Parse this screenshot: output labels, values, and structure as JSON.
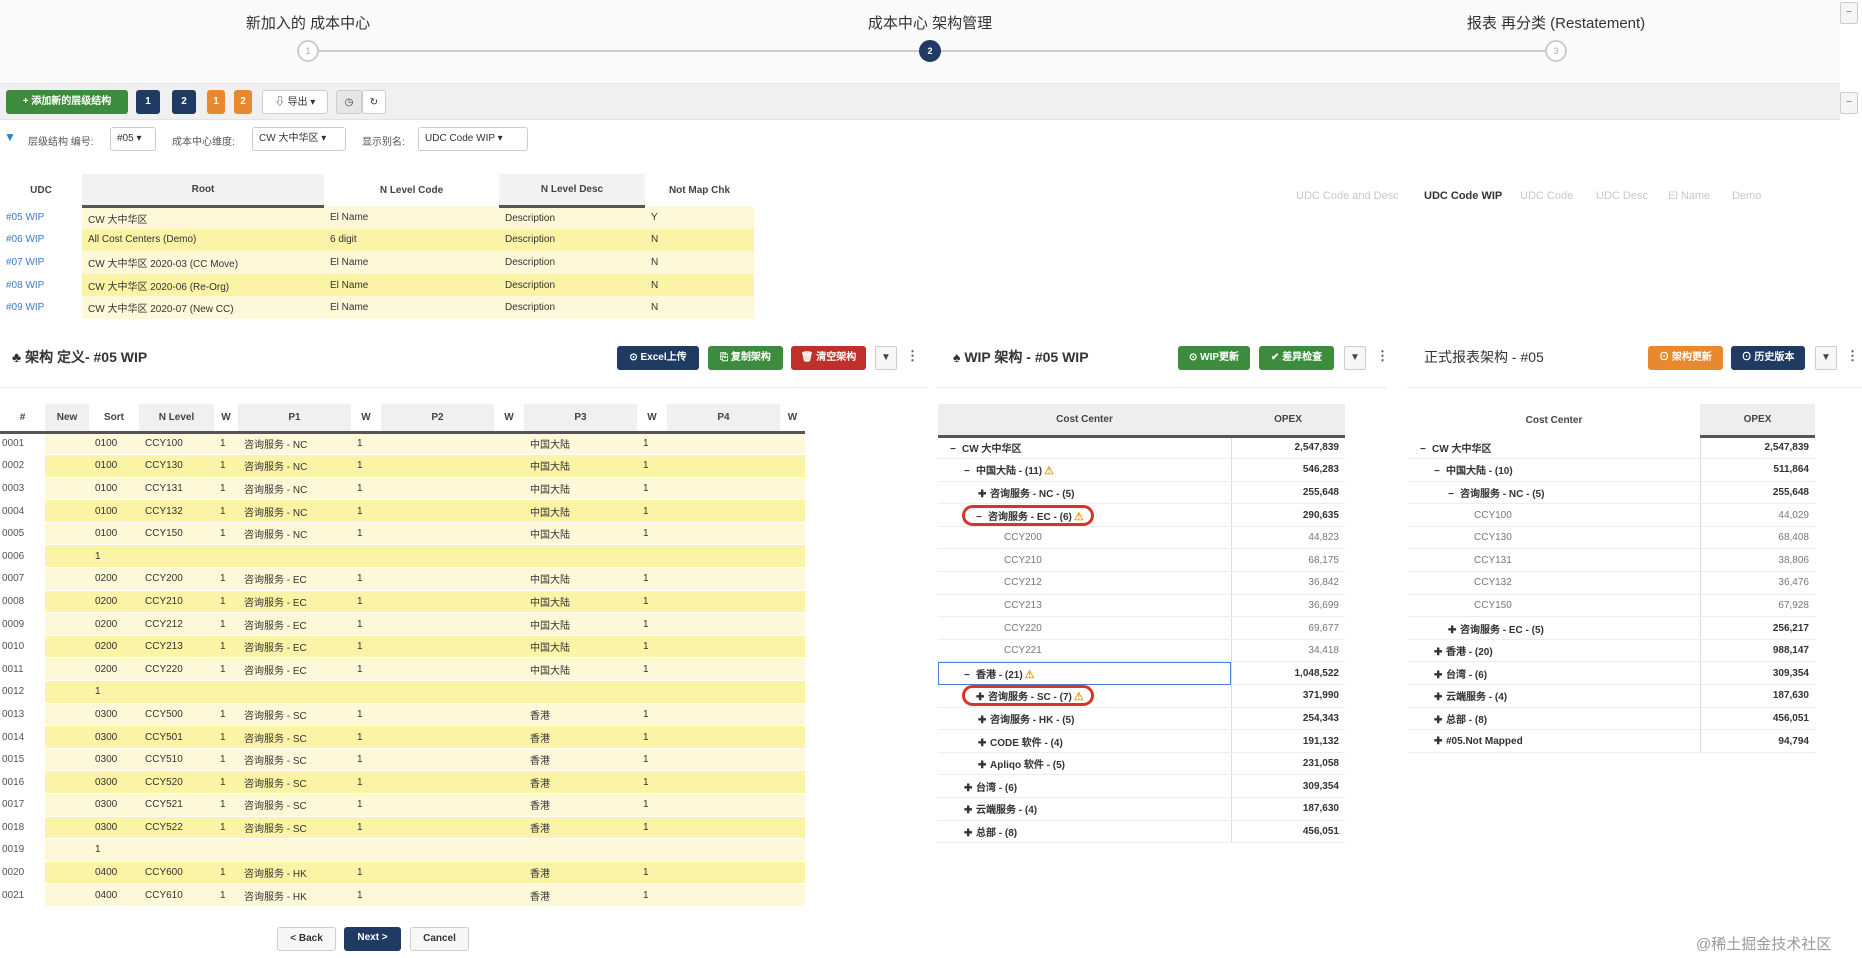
{
  "stepper": {
    "steps": [
      {
        "label": "新加入的 成本中心",
        "num": "1"
      },
      {
        "label": "成本中心 架构管理",
        "num": "2"
      },
      {
        "label": "报表 再分类 (Restatement)",
        "num": "3"
      }
    ],
    "active": 2
  },
  "toolbar": {
    "add": "+ 添加新的层级结构",
    "b1": "1",
    "b2": "2",
    "o1": "1",
    "o2": "2",
    "export": "导出 ▾",
    "history_icon": "clock-icon",
    "refresh_icon": "refresh-icon"
  },
  "filters": {
    "l1": "层级结构 编号:",
    "v1": "#05 ▾",
    "l2": "成本中心维度:",
    "v2": "CW 大中华区 ▾",
    "l3": "显示别名:",
    "v3": "UDC Code WIP ▾"
  },
  "udc_table": {
    "headers": [
      "UDC",
      "Root",
      "N Level Code",
      "N Level Desc",
      "Not Map Chk"
    ],
    "rows": [
      [
        "#05 WIP",
        "CW 大中华区",
        "El Name",
        "Description",
        "Y"
      ],
      [
        "#06 WIP",
        "All Cost Centers (Demo)",
        "6 digit",
        "Description",
        "N"
      ],
      [
        "#07 WIP",
        "CW 大中华区 2020-03 (CC Move)",
        "El Name",
        "Description",
        "N"
      ],
      [
        "#08 WIP",
        "CW 大中华区 2020-06 (Re-Org)",
        "El Name",
        "Description",
        "N"
      ],
      [
        "#09 WIP",
        "CW 大中华区 2020-07 (New CC)",
        "El Name",
        "Description",
        "N"
      ]
    ]
  },
  "view_tabs": [
    {
      "label": "UDC Code and Desc",
      "active": false
    },
    {
      "label": "UDC Code WIP",
      "active": true
    },
    {
      "label": "UDC Code",
      "active": false
    },
    {
      "label": "UDC Desc",
      "active": false
    },
    {
      "label": "El Name",
      "active": false
    },
    {
      "label": "Demo",
      "active": false
    }
  ],
  "left_panel": {
    "title": "架构 定义- #05 WIP",
    "excel": "⊙ Excel上传",
    "copy": "复制架构",
    "clear": "清空架构",
    "headers": [
      "#",
      "New",
      "Sort",
      "N Level",
      "W",
      "P1",
      "W",
      "P2",
      "W",
      "P3",
      "W",
      "P4",
      "W"
    ],
    "rows": [
      [
        "0001",
        "",
        "0100",
        "CCY100",
        "1",
        "咨询服务 - NC",
        "1",
        "",
        "",
        "中国大陆",
        "1",
        "",
        ""
      ],
      [
        "0002",
        "",
        "0100",
        "CCY130",
        "1",
        "咨询服务 - NC",
        "1",
        "",
        "",
        "中国大陆",
        "1",
        "",
        ""
      ],
      [
        "0003",
        "",
        "0100",
        "CCY131",
        "1",
        "咨询服务 - NC",
        "1",
        "",
        "",
        "中国大陆",
        "1",
        "",
        ""
      ],
      [
        "0004",
        "",
        "0100",
        "CCY132",
        "1",
        "咨询服务 - NC",
        "1",
        "",
        "",
        "中国大陆",
        "1",
        "",
        ""
      ],
      [
        "0005",
        "",
        "0100",
        "CCY150",
        "1",
        "咨询服务 - NC",
        "1",
        "",
        "",
        "中国大陆",
        "1",
        "",
        ""
      ],
      [
        "0006",
        "",
        "1",
        "",
        "",
        "",
        "",
        "",
        "",
        "",
        "",
        "",
        ""
      ],
      [
        "0007",
        "",
        "0200",
        "CCY200",
        "1",
        "咨询服务 - EC",
        "1",
        "",
        "",
        "中国大陆",
        "1",
        "",
        ""
      ],
      [
        "0008",
        "",
        "0200",
        "CCY210",
        "1",
        "咨询服务 - EC",
        "1",
        "",
        "",
        "中国大陆",
        "1",
        "",
        ""
      ],
      [
        "0009",
        "",
        "0200",
        "CCY212",
        "1",
        "咨询服务 - EC",
        "1",
        "",
        "",
        "中国大陆",
        "1",
        "",
        ""
      ],
      [
        "0010",
        "",
        "0200",
        "CCY213",
        "1",
        "咨询服务 - EC",
        "1",
        "",
        "",
        "中国大陆",
        "1",
        "",
        ""
      ],
      [
        "0011",
        "",
        "0200",
        "CCY220",
        "1",
        "咨询服务 - EC",
        "1",
        "",
        "",
        "中国大陆",
        "1",
        "",
        ""
      ],
      [
        "0012",
        "",
        "1",
        "",
        "",
        "",
        "",
        "",
        "",
        "",
        "",
        "",
        ""
      ],
      [
        "0013",
        "",
        "0300",
        "CCY500",
        "1",
        "咨询服务 - SC",
        "1",
        "",
        "",
        "香港",
        "1",
        "",
        ""
      ],
      [
        "0014",
        "",
        "0300",
        "CCY501",
        "1",
        "咨询服务 - SC",
        "1",
        "",
        "",
        "香港",
        "1",
        "",
        ""
      ],
      [
        "0015",
        "",
        "0300",
        "CCY510",
        "1",
        "咨询服务 - SC",
        "1",
        "",
        "",
        "香港",
        "1",
        "",
        ""
      ],
      [
        "0016",
        "",
        "0300",
        "CCY520",
        "1",
        "咨询服务 - SC",
        "1",
        "",
        "",
        "香港",
        "1",
        "",
        ""
      ],
      [
        "0017",
        "",
        "0300",
        "CCY521",
        "1",
        "咨询服务 - SC",
        "1",
        "",
        "",
        "香港",
        "1",
        "",
        ""
      ],
      [
        "0018",
        "",
        "0300",
        "CCY522",
        "1",
        "咨询服务 - SC",
        "1",
        "",
        "",
        "香港",
        "1",
        "",
        ""
      ],
      [
        "0019",
        "",
        "1",
        "",
        "",
        "",
        "",
        "",
        "",
        "",
        "",
        "",
        ""
      ],
      [
        "0020",
        "",
        "0400",
        "CCY600",
        "1",
        "咨询服务 - HK",
        "1",
        "",
        "",
        "香港",
        "1",
        "",
        ""
      ],
      [
        "0021",
        "",
        "0400",
        "CCY610",
        "1",
        "咨询服务 - HK",
        "1",
        "",
        "",
        "香港",
        "1",
        "",
        ""
      ]
    ]
  },
  "wip_panel": {
    "title": "WIP 架构 - #05 WIP",
    "update": "⊙ WIP更新",
    "check": "✔ 差异检查",
    "headers": [
      "Cost Center",
      "OPEX"
    ],
    "rows": [
      {
        "level": 0,
        "toggle": "−",
        "label": "CW 大中华区",
        "value": "2,547,839"
      },
      {
        "level": 1,
        "toggle": "−",
        "label": "中国大陆 - (11)",
        "warn": true,
        "value": "546,283"
      },
      {
        "level": 2,
        "toggle": "+",
        "label": "咨询服务 - NC - (5)",
        "value": "255,648"
      },
      {
        "level": 2,
        "toggle": "−",
        "label": "咨询服务 - EC - (6)",
        "warn": true,
        "highlight": true,
        "value": "290,635"
      },
      {
        "level": 3,
        "label": "CCY200",
        "value": "44,823"
      },
      {
        "level": 3,
        "label": "CCY210",
        "value": "68,175"
      },
      {
        "level": 3,
        "label": "CCY212",
        "value": "36,842"
      },
      {
        "level": 3,
        "label": "CCY213",
        "value": "36,699"
      },
      {
        "level": 3,
        "label": "CCY220",
        "value": "69,677"
      },
      {
        "level": 3,
        "label": "CCY221",
        "value": "34,418"
      },
      {
        "level": 1,
        "toggle": "−",
        "label": "香港 - (21)",
        "warn": true,
        "selected": true,
        "value": "1,048,522"
      },
      {
        "level": 2,
        "toggle": "+",
        "label": "咨询服务 - SC - (7)",
        "warn": true,
        "highlight": true,
        "value": "371,990"
      },
      {
        "level": 2,
        "toggle": "+",
        "label": "咨询服务 - HK - (5)",
        "value": "254,343"
      },
      {
        "level": 2,
        "toggle": "+",
        "label": "CODE 软件 - (4)",
        "value": "191,132"
      },
      {
        "level": 2,
        "toggle": "+",
        "label": "Apliqo 软件 - (5)",
        "value": "231,058"
      },
      {
        "level": 1,
        "toggle": "+",
        "label": "台湾 - (6)",
        "value": "309,354"
      },
      {
        "level": 1,
        "toggle": "+",
        "label": "云端服务 - (4)",
        "value": "187,630"
      },
      {
        "level": 1,
        "toggle": "+",
        "label": "总部 - (8)",
        "value": "456,051"
      }
    ]
  },
  "report_panel": {
    "title": "正式报表架构 - #05",
    "update": "⊙ 架构更新",
    "history": "⊙ 历史版本",
    "headers": [
      "Cost Center",
      "OPEX"
    ],
    "rows": [
      {
        "level": 0,
        "toggle": "−",
        "label": "CW 大中华区",
        "value": "2,547,839"
      },
      {
        "level": 1,
        "toggle": "−",
        "label": "中国大陆 - (10)",
        "value": "511,864"
      },
      {
        "level": 2,
        "toggle": "−",
        "label": "咨询服务 - NC - (5)",
        "value": "255,648"
      },
      {
        "level": 3,
        "label": "CCY100",
        "value": "44,029"
      },
      {
        "level": 3,
        "label": "CCY130",
        "value": "68,408"
      },
      {
        "level": 3,
        "label": "CCY131",
        "value": "38,806"
      },
      {
        "level": 3,
        "label": "CCY132",
        "value": "36,476"
      },
      {
        "level": 3,
        "label": "CCY150",
        "value": "67,928"
      },
      {
        "level": 2,
        "toggle": "+",
        "label": "咨询服务 - EC - (5)",
        "value": "256,217"
      },
      {
        "level": 1,
        "toggle": "+",
        "label": "香港 - (20)",
        "value": "988,147"
      },
      {
        "level": 1,
        "toggle": "+",
        "label": "台湾 - (6)",
        "value": "309,354"
      },
      {
        "level": 1,
        "toggle": "+",
        "label": "云端服务 - (4)",
        "value": "187,630"
      },
      {
        "level": 1,
        "toggle": "+",
        "label": "总部 - (8)",
        "value": "456,051"
      },
      {
        "level": 1,
        "toggle": "+",
        "label": "#05.Not Mapped",
        "value": "94,794"
      }
    ]
  },
  "footer": {
    "back": "< Back",
    "next": "Next >",
    "cancel": "Cancel"
  },
  "watermark": "@稀土掘金技术社区",
  "colors": {
    "navy": "#1f3b63",
    "green": "#3d8b3d",
    "orange": "#e8892f",
    "red": "#c0302b",
    "row_yellow": "#fbf3a5",
    "row_light": "#fdf9d8",
    "highlight": "#d9342b"
  }
}
